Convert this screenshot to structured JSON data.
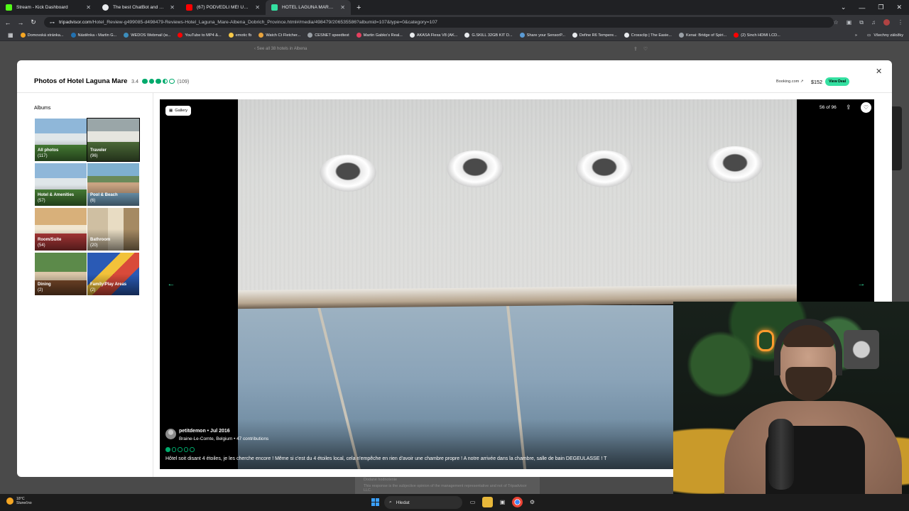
{
  "tabs": [
    {
      "title": "Stream - Kick Dashboard",
      "favicon_color": "#53fc18",
      "active": false
    },
    {
      "title": "The best ChatBot and Widgets",
      "favicon_color": "#e8eaed",
      "active": false
    },
    {
      "title": "(67) PODVEDLI MĚ! UBYTOVALI",
      "favicon_color": "#ff0000",
      "active": false
    },
    {
      "title": "HOTEL LAGUNA MARE - Price",
      "favicon_color": "#34e0a1",
      "active": true
    }
  ],
  "address": {
    "host": "tripadvisor.com",
    "path": "/Hotel_Review-g499085-d498479-Reviews-Hotel_Laguna_Mare-Albena_Dobrich_Province.html#/media/498479/206535586?albumid=107&type=0&category=107"
  },
  "bookmarks": [
    {
      "label": "Domovská stránka...",
      "color": "#f5a623"
    },
    {
      "label": "Nástěnka ‹ Martin G...",
      "color": "#2271b1"
    },
    {
      "label": "WEDOS Webmail (w...",
      "color": "#3c8dbc"
    },
    {
      "label": "YouTube to MP4 &...",
      "color": "#ff0000"
    },
    {
      "label": "emotic fb",
      "color": "#f7c948"
    },
    {
      "label": "Watch Ct Fletcher...",
      "color": "#e8a33d"
    },
    {
      "label": "CESNET speedtest",
      "color": "#9aa0a6"
    },
    {
      "label": "Martin Gabko's Real...",
      "color": "#e4405f"
    },
    {
      "label": "AKASA Flexa V8 (AK...",
      "color": "#e8eaed"
    },
    {
      "label": "G.SKILL 32GB KIT D...",
      "color": "#e8eaed"
    },
    {
      "label": "Share your SensorP...",
      "color": "#5b9bd5"
    },
    {
      "label": "Define R6 Tempere...",
      "color": "#e8eaed"
    },
    {
      "label": "Crossclip | The Easie...",
      "color": "#e8eaed"
    },
    {
      "label": "Kenai: Bridge of Spiri...",
      "color": "#9aa0a6"
    },
    {
      "label": "(2) Sinch HDMI LCD...",
      "color": "#ff0000"
    }
  ],
  "bookmarks_other": "Všechny záložky",
  "page": {
    "back_link": "See all 38 hotels in Albena",
    "note_heading": "Dodané hodnotenie",
    "note_text": "This response is the subjective opinion of the management representative and not of Tripadvisor LLC."
  },
  "modal": {
    "title": "Photos of Hotel Laguna Mare",
    "rating": "3.4",
    "rating_bubbles": 3.5,
    "review_count": "(109)",
    "provider": "Booking.com ↗",
    "price": "$152",
    "deal_label": "View Deal",
    "albums_title": "Albums",
    "albums": [
      {
        "label": "All photos",
        "count": "(117)",
        "selected": false,
        "colors": [
          "#8fb7d9",
          "#dfe6e9",
          "#4d8a3a"
        ]
      },
      {
        "label": "Traveler",
        "count": "(96)",
        "selected": true,
        "colors": [
          "#9aa6a8",
          "#e5e5df",
          "#4e6e3a"
        ]
      },
      {
        "label": "Hotel & Amenities",
        "count": "(57)",
        "selected": false,
        "colors": [
          "#8fb7d9",
          "#dfe6e9",
          "#4d8a3a"
        ]
      },
      {
        "label": "Pool & Beach",
        "count": "(6)",
        "selected": false,
        "colors": [
          "#7fb0d0",
          "#c9a382",
          "#6a8a5a"
        ]
      },
      {
        "label": "Room/Suite",
        "count": "(54)",
        "selected": false,
        "colors": [
          "#d8b07a",
          "#b33a3a",
          "#f1e6d0"
        ]
      },
      {
        "label": "Bathroom",
        "count": "(20)",
        "selected": false,
        "colors": [
          "#cfbfa2",
          "#e8dcc3",
          "#a58a63"
        ]
      },
      {
        "label": "Dining",
        "count": "(2)",
        "selected": false,
        "colors": [
          "#5c8a4a",
          "#7a4a2a",
          "#d9c6a8"
        ]
      },
      {
        "label": "Family/Play Areas",
        "count": "(2)",
        "selected": false,
        "colors": [
          "#2a5ab5",
          "#d94a3a",
          "#f2c23a"
        ]
      }
    ]
  },
  "viewer": {
    "gallery_label": "Gallery",
    "counter": "56 of 96",
    "prev_icon": "arrow-left-icon",
    "next_icon": "arrow-right-icon",
    "author": "petitdemon • Jul 2016",
    "location": "Braine-Le-Comte, Belgium • 47 contributions",
    "review_bubbles": 1,
    "review": "Hôtel soit disant 4 étoiles, je les cherche encore ! Même si c'est du 4 étoiles local, cela n'empêche en rien d'avoir une chambre propre ! A notre arrivée dans la chambre, salle de bain DEGEULASSE ! T"
  },
  "taskbar": {
    "temperature": "18°C",
    "weather": "Slunečno",
    "search_placeholder": "Hledat"
  }
}
